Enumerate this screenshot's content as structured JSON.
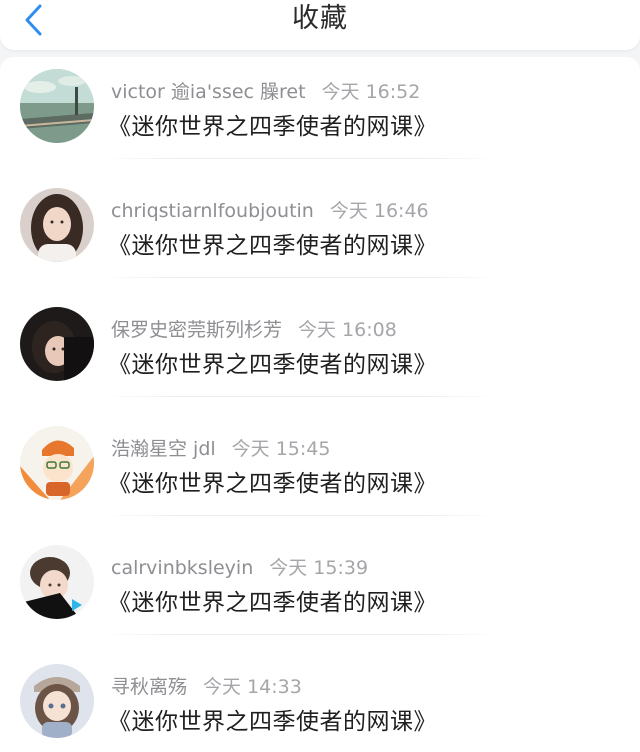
{
  "header": {
    "title": "收藏",
    "back_icon": "chevron-left-icon",
    "accent_color": "#2f8cf0"
  },
  "favorites": [
    {
      "name": "victor 逾ia'ssec 臊ret",
      "time": "今天 16:52",
      "course": "《迷你世界之四季使者的网课》"
    },
    {
      "name": "chriqstiarnlfoubjoutin",
      "time": "今天 16:46",
      "course": "《迷你世界之四季使者的网课》"
    },
    {
      "name": "保罗史密莞斯列杉芳",
      "time": "今天 16:08",
      "course": "《迷你世界之四季使者的网课》"
    },
    {
      "name": "浩瀚星空 jdl",
      "time": "今天 15:45",
      "course": "《迷你世界之四季使者的网课》"
    },
    {
      "name": "calrvinbksleyin",
      "time": "今天 15:39",
      "course": "《迷你世界之四季使者的网课》"
    },
    {
      "name": "寻秋离殇",
      "time": "今天 14:33",
      "course": "《迷你世界之四季使者的网课》"
    }
  ]
}
